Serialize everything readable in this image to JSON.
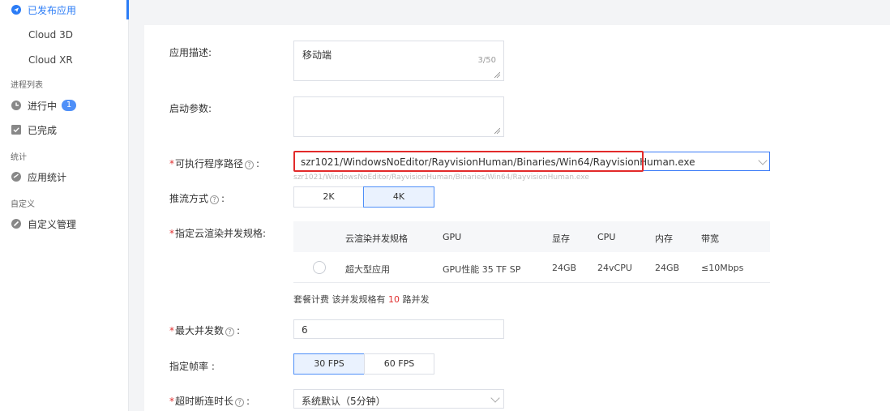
{
  "sidebar": {
    "published_apps": "已发布应用",
    "sub_items": [
      "Cloud 3D",
      "Cloud XR"
    ],
    "process_group": "进程列表",
    "running": "进行中",
    "running_count": "1",
    "completed": "已完成",
    "stats_group": "统计",
    "app_stats": "应用统计",
    "custom_group": "自定义",
    "custom_manage": "自定义管理"
  },
  "form": {
    "description_label": "应用描述:",
    "description_value": "移动端",
    "description_counter": "3/50",
    "launch_params_label": "启动参数:",
    "launch_params_value": "",
    "exe_path_label": "可执行程序路径",
    "exe_path_value": "szr1021/WindowsNoEditor/RayvisionHuman/Binaries/Win64/RayvisionHuman.exe",
    "exe_path_hint": "szr1021/WindowsNoEditor/RayvisionHuman/Binaries/Win64/RayvisionHuman.exe",
    "stream_label": "推流方式",
    "stream_options": [
      "2K",
      "4K"
    ],
    "stream_selected": "4K",
    "spec_label": "指定云渲染并发规格:",
    "spec_table": {
      "headers": [
        "云渲染并发规格",
        "GPU",
        "显存",
        "CPU",
        "内存",
        "带宽"
      ],
      "rows": [
        [
          "超大型应用",
          "GPU性能 35 TF SP",
          "24GB",
          "24vCPU",
          "24GB",
          "≤10Mbps"
        ]
      ]
    },
    "package_prefix": "套餐计费 该并发规格有",
    "package_count": "10",
    "package_suffix": "路并发",
    "max_concurrency_label": "最大并发数",
    "max_concurrency_value": "6",
    "fps_label": "指定帧率 :",
    "fps_options": [
      "30 FPS",
      "60 FPS"
    ],
    "fps_selected": "30 FPS",
    "timeout_label": "超时断连时长",
    "timeout_value": "系统默认（5分钟）"
  },
  "colors": {
    "accent": "#2b7cf6",
    "required": "#e03030",
    "highlight_box": "#e22a2a"
  }
}
